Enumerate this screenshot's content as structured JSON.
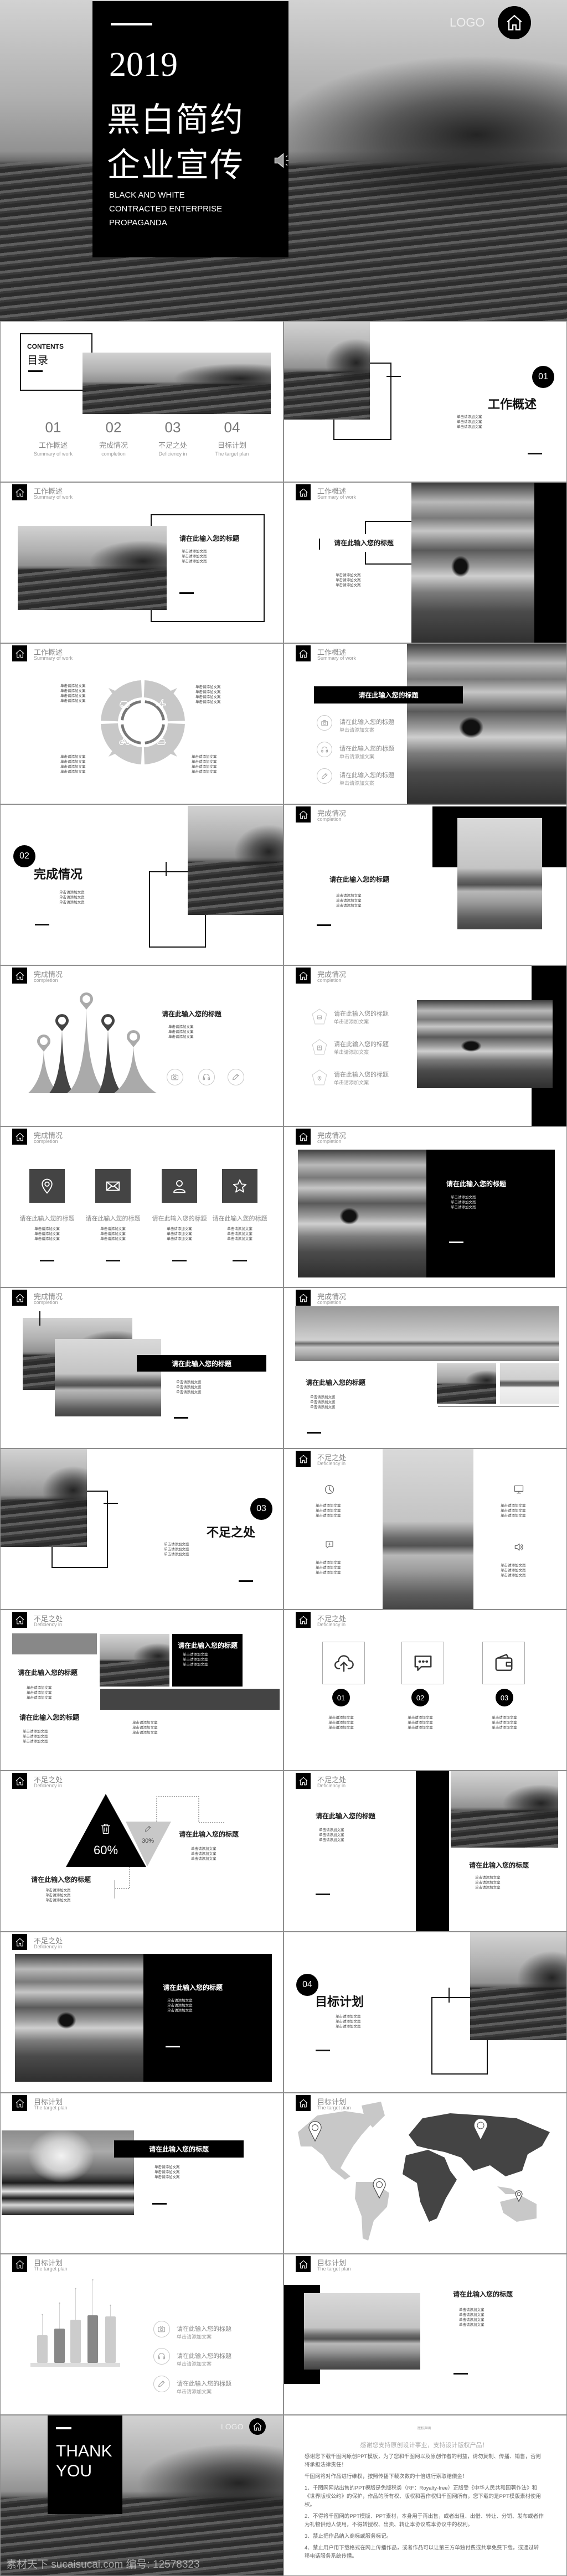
{
  "hero": {
    "year": "2019",
    "title_line1": "黑白简约",
    "title_line2": "企业宣传",
    "subtitle_lines": [
      "BLACK AND WHITE",
      "CONTRACTED ENTERPRISE",
      "PROPAGANDA"
    ],
    "logo": "LOGO"
  },
  "contents": {
    "heading_en": "CONTENTS",
    "heading_cn": "目录",
    "items": [
      {
        "num": "01",
        "cn": "工作概述",
        "en": "Summary of work"
      },
      {
        "num": "02",
        "cn": "完成情况",
        "en": "completion"
      },
      {
        "num": "03",
        "cn": "不足之处",
        "en": "Deficiency in"
      },
      {
        "num": "04",
        "cn": "目标计划",
        "en": "The target plan"
      }
    ]
  },
  "sections": [
    {
      "num": "01",
      "cn": "工作概述",
      "en": "Summary of work"
    },
    {
      "num": "02",
      "cn": "完成情况",
      "en": "completion"
    },
    {
      "num": "03",
      "cn": "不足之处",
      "en": "Deficiency in"
    },
    {
      "num": "04",
      "cn": "目标计划",
      "en": "The target plan"
    }
  ],
  "placeholders": {
    "title": "请在此输入您的标题",
    "text": "单击请添加文案"
  },
  "steps": [
    "01",
    "02",
    "03"
  ],
  "stats": {
    "big": "60%",
    "small": "30%"
  },
  "icons": {
    "circle_diagram": [
      "car",
      "plane",
      "bike",
      "ship"
    ],
    "feature_list": [
      "camera",
      "headphones",
      "pencil"
    ],
    "feature_boxes": [
      "pin",
      "mail",
      "user",
      "star"
    ],
    "deficiency_icons": [
      "clock",
      "chat-plus",
      "monitor",
      "speaker"
    ],
    "step_boxes": [
      "cloud-upload",
      "chat-dots",
      "wallet"
    ],
    "pentagon_list": [
      "photo",
      "id-card",
      "location"
    ]
  },
  "thanks": {
    "line1": "THANK",
    "line2": "YOU",
    "logo": "LOGO",
    "watermark": "素材天下 sucaisucai.com 编号: 12578323"
  },
  "copyright": {
    "heading": "版权声明",
    "subtitle": "感谢您支持原创设计事业，支持设计版权产品！",
    "paragraphs": [
      "感谢您下载千图网原创PPT模板，为了您和千图网以及原创作者的利益，请勿复制、传播、销售，否则将承担法律责任！",
      "千图网将对作品进行维权，按照传播下载次数的十倍进行索取赔偿金！",
      "1、千图网网站出售的PPT模版是免版税类（RF：Royalty-free）正版受《中华人民共和国著作法》和《世界版权公约》的保护，作品的所有权、版权和著作权归千图网所有，您下载的是PPT模版素材使用权。",
      "2、不得将千图网的PPT模版、PPT素材，本身用于再出售，或者出租、出借、转让、分销、发布或者作为礼物供他人使用，不得转授权、出卖、转让本协议或本协议中的权利。",
      "3、禁止把作品纳入商标或服务标记。",
      "4、禁止用户用下载格式在网上传播作品，或者作品可以让第三方单独付费或共享免费下载，或通过转移电话服务系统传播。"
    ]
  },
  "colors": {
    "black": "#000000",
    "dark_gray": "#444444",
    "mid_gray": "#888888",
    "light_gray": "#c8c8c8",
    "background": "#ffffff"
  }
}
